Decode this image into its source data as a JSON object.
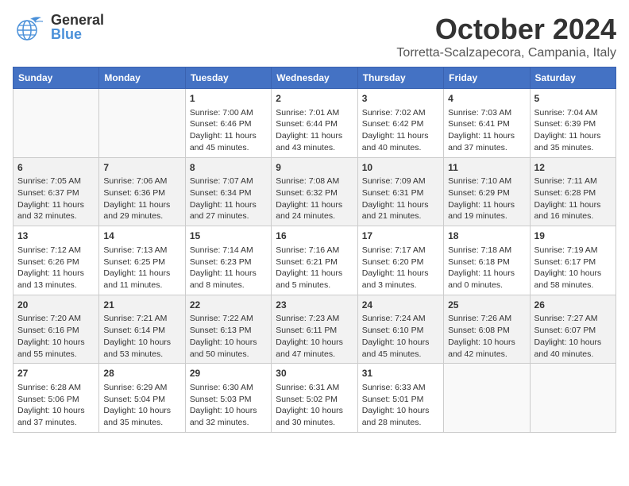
{
  "header": {
    "logo_line1": "General",
    "logo_line2": "Blue",
    "month": "October 2024",
    "location": "Torretta-Scalzapecora, Campania, Italy"
  },
  "days_of_week": [
    "Sunday",
    "Monday",
    "Tuesday",
    "Wednesday",
    "Thursday",
    "Friday",
    "Saturday"
  ],
  "weeks": [
    [
      {
        "day": "",
        "info": ""
      },
      {
        "day": "",
        "info": ""
      },
      {
        "day": "1",
        "info": "Sunrise: 7:00 AM\nSunset: 6:46 PM\nDaylight: 11 hours and 45 minutes."
      },
      {
        "day": "2",
        "info": "Sunrise: 7:01 AM\nSunset: 6:44 PM\nDaylight: 11 hours and 43 minutes."
      },
      {
        "day": "3",
        "info": "Sunrise: 7:02 AM\nSunset: 6:42 PM\nDaylight: 11 hours and 40 minutes."
      },
      {
        "day": "4",
        "info": "Sunrise: 7:03 AM\nSunset: 6:41 PM\nDaylight: 11 hours and 37 minutes."
      },
      {
        "day": "5",
        "info": "Sunrise: 7:04 AM\nSunset: 6:39 PM\nDaylight: 11 hours and 35 minutes."
      }
    ],
    [
      {
        "day": "6",
        "info": "Sunrise: 7:05 AM\nSunset: 6:37 PM\nDaylight: 11 hours and 32 minutes."
      },
      {
        "day": "7",
        "info": "Sunrise: 7:06 AM\nSunset: 6:36 PM\nDaylight: 11 hours and 29 minutes."
      },
      {
        "day": "8",
        "info": "Sunrise: 7:07 AM\nSunset: 6:34 PM\nDaylight: 11 hours and 27 minutes."
      },
      {
        "day": "9",
        "info": "Sunrise: 7:08 AM\nSunset: 6:32 PM\nDaylight: 11 hours and 24 minutes."
      },
      {
        "day": "10",
        "info": "Sunrise: 7:09 AM\nSunset: 6:31 PM\nDaylight: 11 hours and 21 minutes."
      },
      {
        "day": "11",
        "info": "Sunrise: 7:10 AM\nSunset: 6:29 PM\nDaylight: 11 hours and 19 minutes."
      },
      {
        "day": "12",
        "info": "Sunrise: 7:11 AM\nSunset: 6:28 PM\nDaylight: 11 hours and 16 minutes."
      }
    ],
    [
      {
        "day": "13",
        "info": "Sunrise: 7:12 AM\nSunset: 6:26 PM\nDaylight: 11 hours and 13 minutes."
      },
      {
        "day": "14",
        "info": "Sunrise: 7:13 AM\nSunset: 6:25 PM\nDaylight: 11 hours and 11 minutes."
      },
      {
        "day": "15",
        "info": "Sunrise: 7:14 AM\nSunset: 6:23 PM\nDaylight: 11 hours and 8 minutes."
      },
      {
        "day": "16",
        "info": "Sunrise: 7:16 AM\nSunset: 6:21 PM\nDaylight: 11 hours and 5 minutes."
      },
      {
        "day": "17",
        "info": "Sunrise: 7:17 AM\nSunset: 6:20 PM\nDaylight: 11 hours and 3 minutes."
      },
      {
        "day": "18",
        "info": "Sunrise: 7:18 AM\nSunset: 6:18 PM\nDaylight: 11 hours and 0 minutes."
      },
      {
        "day": "19",
        "info": "Sunrise: 7:19 AM\nSunset: 6:17 PM\nDaylight: 10 hours and 58 minutes."
      }
    ],
    [
      {
        "day": "20",
        "info": "Sunrise: 7:20 AM\nSunset: 6:16 PM\nDaylight: 10 hours and 55 minutes."
      },
      {
        "day": "21",
        "info": "Sunrise: 7:21 AM\nSunset: 6:14 PM\nDaylight: 10 hours and 53 minutes."
      },
      {
        "day": "22",
        "info": "Sunrise: 7:22 AM\nSunset: 6:13 PM\nDaylight: 10 hours and 50 minutes."
      },
      {
        "day": "23",
        "info": "Sunrise: 7:23 AM\nSunset: 6:11 PM\nDaylight: 10 hours and 47 minutes."
      },
      {
        "day": "24",
        "info": "Sunrise: 7:24 AM\nSunset: 6:10 PM\nDaylight: 10 hours and 45 minutes."
      },
      {
        "day": "25",
        "info": "Sunrise: 7:26 AM\nSunset: 6:08 PM\nDaylight: 10 hours and 42 minutes."
      },
      {
        "day": "26",
        "info": "Sunrise: 7:27 AM\nSunset: 6:07 PM\nDaylight: 10 hours and 40 minutes."
      }
    ],
    [
      {
        "day": "27",
        "info": "Sunrise: 6:28 AM\nSunset: 5:06 PM\nDaylight: 10 hours and 37 minutes."
      },
      {
        "day": "28",
        "info": "Sunrise: 6:29 AM\nSunset: 5:04 PM\nDaylight: 10 hours and 35 minutes."
      },
      {
        "day": "29",
        "info": "Sunrise: 6:30 AM\nSunset: 5:03 PM\nDaylight: 10 hours and 32 minutes."
      },
      {
        "day": "30",
        "info": "Sunrise: 6:31 AM\nSunset: 5:02 PM\nDaylight: 10 hours and 30 minutes."
      },
      {
        "day": "31",
        "info": "Sunrise: 6:33 AM\nSunset: 5:01 PM\nDaylight: 10 hours and 28 minutes."
      },
      {
        "day": "",
        "info": ""
      },
      {
        "day": "",
        "info": ""
      }
    ]
  ]
}
